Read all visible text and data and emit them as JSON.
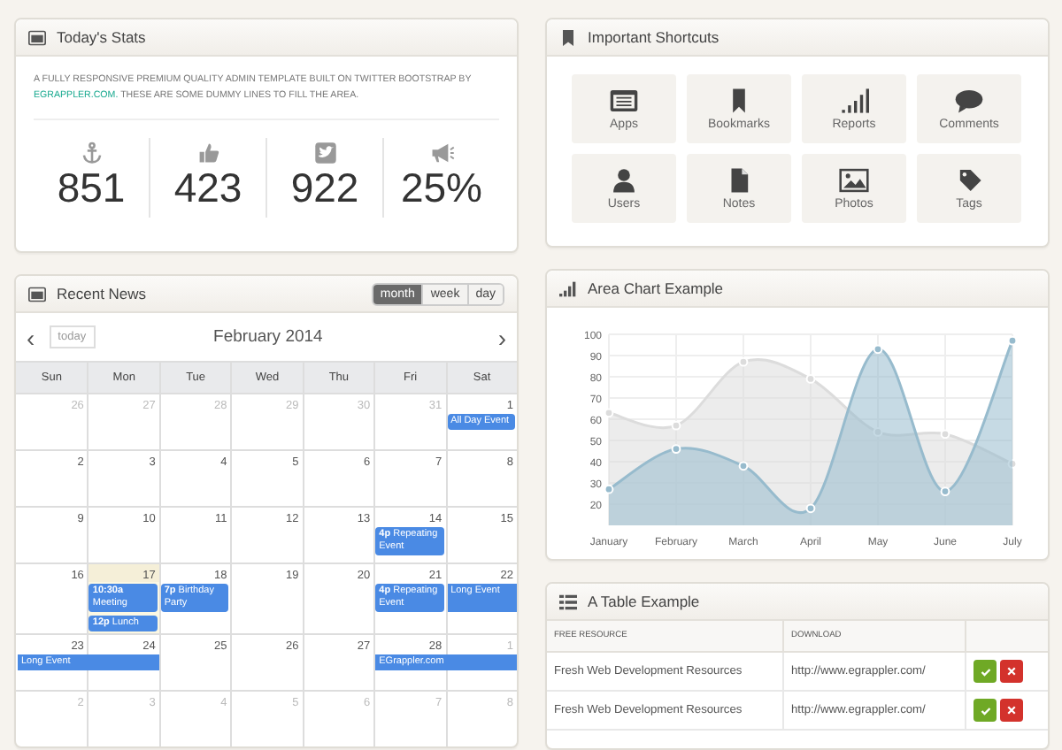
{
  "stats": {
    "title": "Today's Stats",
    "intro_start": "A FULLY RESPONSIVE PREMIUM QUALITY ADMIN TEMPLATE BUILT ON TWITTER BOOTSTRAP BY",
    "link": "EGRAPPLER.COM.",
    "intro_end": "THESE ARE SOME DUMMY LINES TO FILL THE AREA.",
    "items": [
      {
        "kind": "anchor",
        "value": "851"
      },
      {
        "kind": "like",
        "value": "423"
      },
      {
        "kind": "bird",
        "value": "922"
      },
      {
        "kind": "megaphone",
        "value": "25%"
      }
    ]
  },
  "shortcuts": {
    "title": "Important Shortcuts",
    "items": [
      {
        "kind": "apps",
        "label": "Apps"
      },
      {
        "kind": "bookmark",
        "label": "Bookmarks"
      },
      {
        "kind": "signal",
        "label": "Reports"
      },
      {
        "kind": "comment",
        "label": "Comments"
      },
      {
        "kind": "user",
        "label": "Users"
      },
      {
        "kind": "file",
        "label": "Notes"
      },
      {
        "kind": "photo",
        "label": "Photos"
      },
      {
        "kind": "tag",
        "label": "Tags"
      }
    ]
  },
  "calendar": {
    "title": "Recent News",
    "views": [
      {
        "label": "month",
        "selected": true
      },
      {
        "label": "week",
        "selected": false
      },
      {
        "label": "day",
        "selected": false
      }
    ],
    "prev": "‹",
    "next": "›",
    "today": "today",
    "month": "February 2014",
    "weekdays": [
      "Sun",
      "Mon",
      "Tue",
      "Wed",
      "Thu",
      "Fri",
      "Sat"
    ],
    "weeks": [
      [
        {
          "day": "26",
          "other": true
        },
        {
          "day": "27",
          "other": true
        },
        {
          "day": "28",
          "other": true
        },
        {
          "day": "29",
          "other": true
        },
        {
          "day": "30",
          "other": true
        },
        {
          "day": "31",
          "other": true
        },
        {
          "day": "1",
          "other": false,
          "events": [
            {
              "text": "All Day Event",
              "continues": false
            }
          ]
        }
      ],
      [
        {
          "day": "2",
          "other": false
        },
        {
          "day": "3",
          "other": false
        },
        {
          "day": "4",
          "other": false
        },
        {
          "day": "5",
          "other": false
        },
        {
          "day": "6",
          "other": false
        },
        {
          "day": "7",
          "other": false
        },
        {
          "day": "8",
          "other": false
        }
      ],
      [
        {
          "day": "9",
          "other": false
        },
        {
          "day": "10",
          "other": false
        },
        {
          "day": "11",
          "other": false
        },
        {
          "day": "12",
          "other": false
        },
        {
          "day": "13",
          "other": false
        },
        {
          "day": "14",
          "other": false,
          "events": [
            {
              "text": "**4p** Repeating Event",
              "continues": false
            }
          ]
        },
        {
          "day": "15",
          "other": false
        }
      ],
      [
        {
          "day": "16",
          "other": false
        },
        {
          "day": "17",
          "other": false,
          "today": true,
          "events": [
            {
              "text": "**10:30a** Meeting",
              "continues": false
            },
            {
              "text": "**12p** Lunch",
              "continues": false
            }
          ]
        },
        {
          "day": "18",
          "other": false,
          "events": [
            {
              "text": "**7p** Birthday Party",
              "continues": false
            }
          ]
        },
        {
          "day": "19",
          "other": false
        },
        {
          "day": "20",
          "other": false
        },
        {
          "day": "21",
          "other": false,
          "events": [
            {
              "text": "**4p** Repeating Event",
              "continues": false
            }
          ]
        },
        {
          "day": "22",
          "other": false,
          "events": [
            {
              "text": "Long Event",
              "continues": true
            }
          ]
        }
      ],
      [
        {
          "day": "23",
          "other": false,
          "events": [
            {
              "text": "Long Event",
              "continues": true
            }
          ]
        },
        {
          "day": "24",
          "other": false
        },
        {
          "day": "25",
          "other": false
        },
        {
          "day": "26",
          "other": false
        },
        {
          "day": "27",
          "other": false
        },
        {
          "day": "28",
          "other": false,
          "events": [
            {
              "text": "EGrappler.com",
              "continues": true
            }
          ]
        },
        {
          "day": "1",
          "other": true
        }
      ],
      [
        {
          "day": "2",
          "other": true
        },
        {
          "day": "3",
          "other": true
        },
        {
          "day": "4",
          "other": true
        },
        {
          "day": "5",
          "other": true
        },
        {
          "day": "6",
          "other": true
        },
        {
          "day": "7",
          "other": true
        },
        {
          "day": "8",
          "other": true
        }
      ]
    ]
  },
  "area_chart": {
    "title": "Area Chart Example",
    "chart_data": {
      "type": "area",
      "categories": [
        "January",
        "February",
        "March",
        "April",
        "May",
        "June",
        "July"
      ],
      "series": [
        {
          "color": "#dcdcdc",
          "values": [
            63,
            57,
            87,
            79,
            54,
            53,
            39
          ]
        },
        {
          "color": "#97bbcd",
          "values": [
            27,
            46,
            38,
            18,
            93,
            26,
            97
          ]
        }
      ],
      "ylim": [
        10,
        100
      ],
      "grid": true,
      "yticks": [
        20,
        30,
        40,
        50,
        60,
        70,
        80,
        90,
        100
      ]
    }
  },
  "table": {
    "title": "A Table Example",
    "columns": [
      "FREE RESOURCE",
      "DOWNLOAD"
    ],
    "rows": [
      {
        "resource": "Fresh Web Development Resources",
        "download": "http://www.egrappler.com/"
      },
      {
        "resource": "Fresh Web Development Resources",
        "download": "http://www.egrappler.com/"
      }
    ]
  }
}
